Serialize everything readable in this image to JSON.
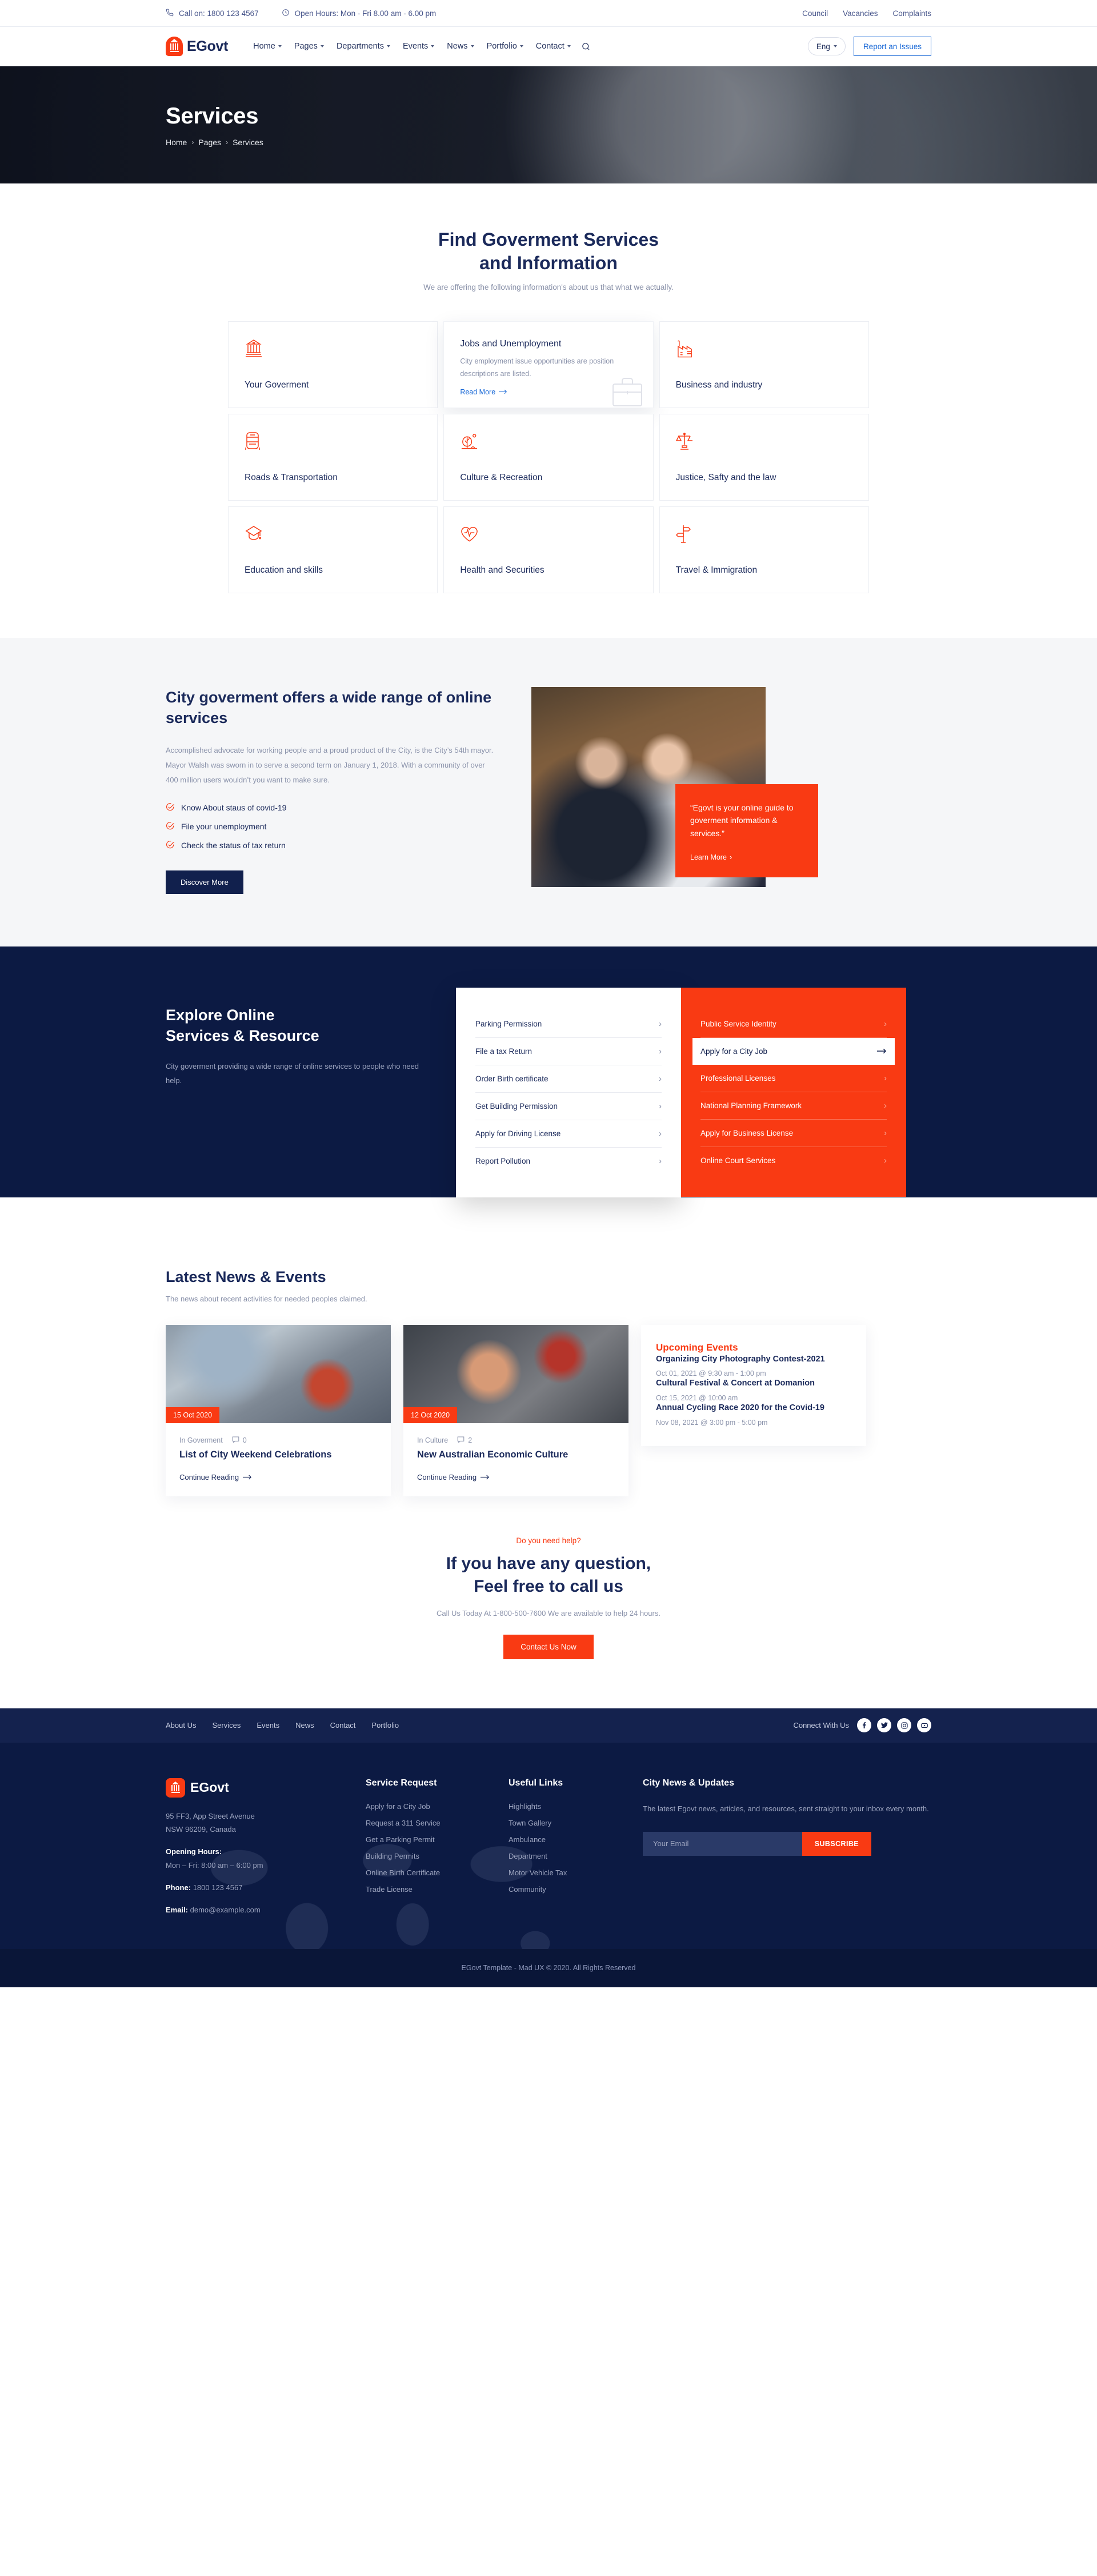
{
  "colors": {
    "accent": "#f93a13",
    "navy": "#1b2a5b",
    "deep_navy": "#0c1a43",
    "link_blue": "#1767d6"
  },
  "topbar": {
    "phone": "Call on: 1800 123  4567",
    "hours": "Open Hours: Mon - Fri 8.00 am - 6.00 pm",
    "links": [
      "Council",
      "Vacancies",
      "Complaints"
    ]
  },
  "nav": {
    "brand": "EGovt",
    "items": [
      "Home",
      "Pages",
      "Departments",
      "Events",
      "News",
      "Portfolio",
      "Contact"
    ],
    "lang": "Eng",
    "report_label": "Report an Issues"
  },
  "hero": {
    "title": "Services",
    "breadcrumb": [
      "Home",
      "Pages",
      "Services"
    ]
  },
  "services": {
    "heading_line1": "Find Goverment Services",
    "heading_line2": "and Information",
    "subheading": "We are offering the following information's about us that what we actually.",
    "cards": [
      {
        "title": "Your Goverment",
        "icon": "government-building-icon"
      },
      {
        "title": "Jobs and Unemployment",
        "icon": "briefcase-icon",
        "desc": "City employment issue opportunities are position descriptions are listed.",
        "more": "Read More",
        "active": true
      },
      {
        "title": "Business and industry",
        "icon": "factory-icon"
      },
      {
        "title": "Roads & Transportation",
        "icon": "bus-icon"
      },
      {
        "title": "Culture & Recreation",
        "icon": "park-tree-icon"
      },
      {
        "title": "Justice, Safty and the law",
        "icon": "scales-icon"
      },
      {
        "title": "Education and skills",
        "icon": "graduation-cap-icon"
      },
      {
        "title": "Health and Securities",
        "icon": "heart-pulse-icon"
      },
      {
        "title": "Travel & Immigration",
        "icon": "signpost-icon"
      }
    ]
  },
  "offers": {
    "title": "City goverment offers a wide range of online services",
    "paragraph": "Accomplished advocate for working people and a proud product of the City, is the City’s 54th mayor. Mayor Walsh was sworn in to serve a second term on January 1, 2018. With a community of over 400 million users wouldn’t you want to make sure.",
    "checks": [
      "Know About staus of covid-19",
      "File your unemployment",
      "Check the status of tax return"
    ],
    "button": "Discover More",
    "quote": "“Egovt is your online guide to goverment information & services.”",
    "quote_link": "Learn More"
  },
  "explore": {
    "title_line1": "Explore Online",
    "title_line2": "Services & Resource",
    "description": "City goverment providing a wide range of online services to people who need help.",
    "left_list": [
      "Parking Permission",
      "File a tax Return",
      "Order Birth certificate",
      "Get Building Permission",
      "Apply for Driving License",
      "Report Pollution"
    ],
    "right_list": [
      {
        "label": "Public Service Identity",
        "highlighted": false
      },
      {
        "label": "Apply for a City Job",
        "highlighted": true
      },
      {
        "label": "Professional Licenses",
        "highlighted": false
      },
      {
        "label": "National Planning Framework",
        "highlighted": false
      },
      {
        "label": "Apply for Business License",
        "highlighted": false
      },
      {
        "label": "Online Court Services",
        "highlighted": false
      }
    ]
  },
  "news": {
    "title": "Latest News & Events",
    "subtitle": "The news about recent activities for needed peoples claimed.",
    "posts": [
      {
        "date": "15 Oct 2020",
        "category": "In Goverment",
        "comments": "0",
        "title": "List of City Weekend Celebrations",
        "link": "Continue Reading"
      },
      {
        "date": "12 Oct 2020",
        "category": "In Culture",
        "comments": "2",
        "title": "New Australian Economic Culture",
        "link": "Continue Reading"
      }
    ],
    "events_title": "Upcoming Events",
    "events": [
      {
        "title": "Organizing City Photography Contest-2021",
        "when": "Oct 01, 2021 @ 9:30 am - 1:00 pm"
      },
      {
        "title": "Cultural Festival & Concert at Domanion",
        "when": "Oct 15, 2021 @ 10:00 am"
      },
      {
        "title": "Annual Cycling Race 2020 for the Covid-19",
        "when": "Nov 08, 2021 @ 3:00 pm - 5:00 pm"
      }
    ]
  },
  "cta": {
    "kicker": "Do you need help?",
    "line1": "If you have any question,",
    "line2": "Feel free to call us",
    "note": "Call Us Today At 1-800-500-7600 We are available to help 24 hours.",
    "button": "Contact Us Now"
  },
  "footer": {
    "top_links": [
      "About Us",
      "Services",
      "Events",
      "News",
      "Contact",
      "Portfolio"
    ],
    "connect_label": "Connect With Us",
    "socials": [
      "facebook-icon",
      "twitter-icon",
      "instagram-icon",
      "youtube-icon"
    ],
    "brand": "EGovt",
    "address_line1": "95 FF3, App Street Avenue",
    "address_line2": "NSW 96209, Canada",
    "hours_label": "Opening Hours:",
    "hours_value": "Mon – Fri: 8:00 am – 6:00 pm",
    "phone_label": "Phone:",
    "phone_value": "1800 123 4567",
    "email_label": "Email:",
    "email_value": "demo@example.com",
    "col2_title": "Service Request",
    "col2_links": [
      "Apply for a City Job",
      "Request a 311 Service",
      "Get a Parking Permit",
      "Building Permits",
      "Online Birth Certificate",
      "Trade License"
    ],
    "col3_title": "Useful Links",
    "col3_links": [
      "Highlights",
      "Town Gallery",
      "Ambulance",
      "Department",
      "Motor Vehicle Tax",
      "Community"
    ],
    "col4_title": "City News & Updates",
    "col4_desc": "The latest Egovt news, articles, and resources, sent straight to your inbox every month.",
    "email_placeholder": "Your Email",
    "email_value_field": "",
    "subscribe": "SUBSCRIBE",
    "copyright": "EGovt Template - Mad UX © 2020. All Rights Reserved"
  }
}
